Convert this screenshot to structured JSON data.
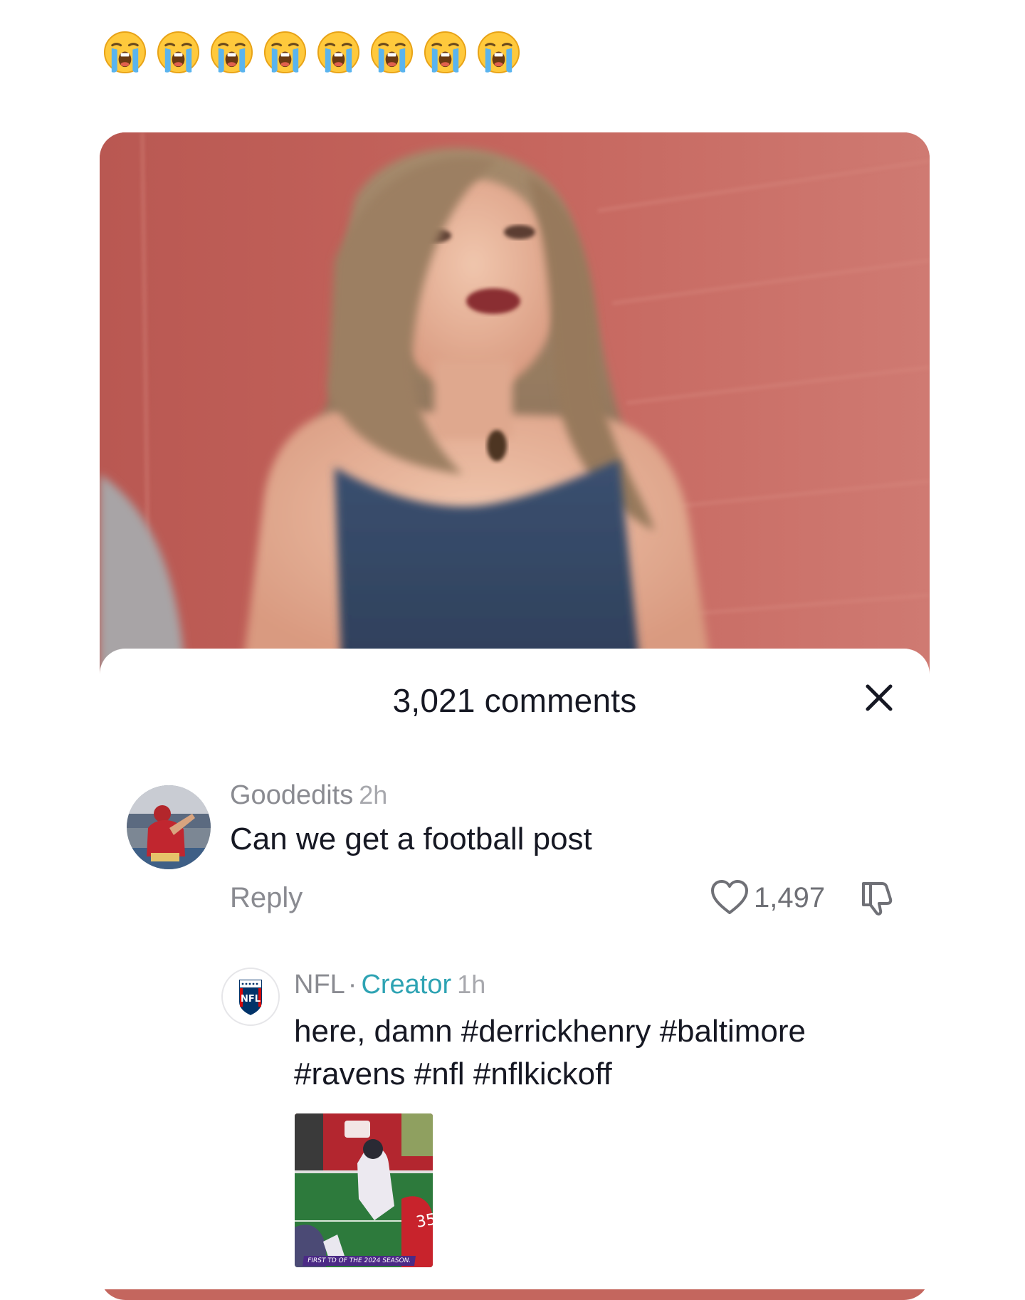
{
  "emoji_row": {
    "icon": "loudly-crying-face-icon",
    "count": 8
  },
  "video": {
    "description_icon": "video-still"
  },
  "comments_sheet": {
    "title": "3,021 comments",
    "close_icon": "close-icon"
  },
  "comments": [
    {
      "username": "Goodedits",
      "timestamp": "2h",
      "text": "Can we get a football post",
      "reply_label": "Reply",
      "like_count": "1,497",
      "avatar_icon": "football-player-avatar"
    }
  ],
  "replies": [
    {
      "username": "NFL",
      "separator": "·",
      "badge": "Creator",
      "timestamp": "1h",
      "text_line1": "here, damn #derrickhenry #baltimore",
      "text_line2": "#ravens #nfl #nflkickoff",
      "avatar_icon": "nfl-logo",
      "thumbnail_caption": "FIRST TD OF THE 2024 SEASON."
    }
  ],
  "colors": {
    "creator_badge": "#2ea3b3",
    "muted_text": "#8a8b91",
    "primary_text": "#161823",
    "wall": "#c4665e"
  }
}
